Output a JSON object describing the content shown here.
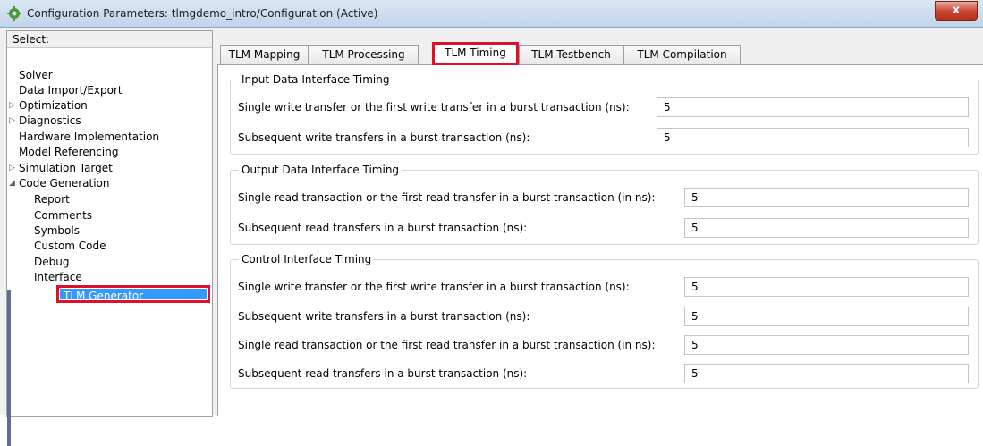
{
  "window": {
    "title": "Configuration Parameters: tlmgdemo_intro/Configuration (Active)",
    "close_label": "x"
  },
  "sidebar": {
    "header": "Select:",
    "items": [
      {
        "label": "Solver"
      },
      {
        "label": "Data Import/Export"
      },
      {
        "label": "Optimization"
      },
      {
        "label": "Diagnostics"
      },
      {
        "label": "Hardware Implementation"
      },
      {
        "label": "Model Referencing"
      },
      {
        "label": "Simulation Target"
      },
      {
        "label": "Code Generation"
      },
      {
        "label": "Report"
      },
      {
        "label": "Comments"
      },
      {
        "label": "Symbols"
      },
      {
        "label": "Custom Code"
      },
      {
        "label": "Debug"
      },
      {
        "label": "Interface"
      },
      {
        "label": "TLM Generator"
      }
    ],
    "selected": "TLM Generator"
  },
  "tabs": [
    {
      "label": "TLM Mapping"
    },
    {
      "label": "TLM Processing"
    },
    {
      "label": "TLM Timing"
    },
    {
      "label": "TLM Testbench"
    },
    {
      "label": "TLM Compilation"
    }
  ],
  "active_tab": "TLM Timing",
  "groups": {
    "input": {
      "title": "Input Data Interface Timing",
      "rows": [
        {
          "label": "Single write transfer or the first write transfer in a burst transaction (ns):",
          "value": "5"
        },
        {
          "label": "Subsequent write transfers in a burst transaction (ns):",
          "value": "5"
        }
      ]
    },
    "output": {
      "title": "Output Data Interface Timing",
      "rows": [
        {
          "label": "Single read transaction or the first read transfer in a burst transaction (in ns):",
          "value": "5"
        },
        {
          "label": "Subsequent read transfers in a burst transaction (ns):",
          "value": "5"
        }
      ]
    },
    "control": {
      "title": "Control Interface Timing",
      "rows": [
        {
          "label": "Single write transfer or the first write transfer in a burst transaction (ns):",
          "value": "5"
        },
        {
          "label": "Subsequent write transfers in a burst transaction (ns):",
          "value": "5"
        },
        {
          "label": "Single read transaction or the first read transfer in a burst transaction (in ns):",
          "value": "5"
        },
        {
          "label": "Subsequent read transfers in a burst transaction (ns):",
          "value": "5"
        }
      ]
    }
  },
  "colors": {
    "highlight": "#e0102a",
    "selection": "#3399ff"
  },
  "icons": {
    "app": "gear-icon",
    "expand": "triangle-right-icon",
    "collapse": "triangle-down-icon"
  }
}
